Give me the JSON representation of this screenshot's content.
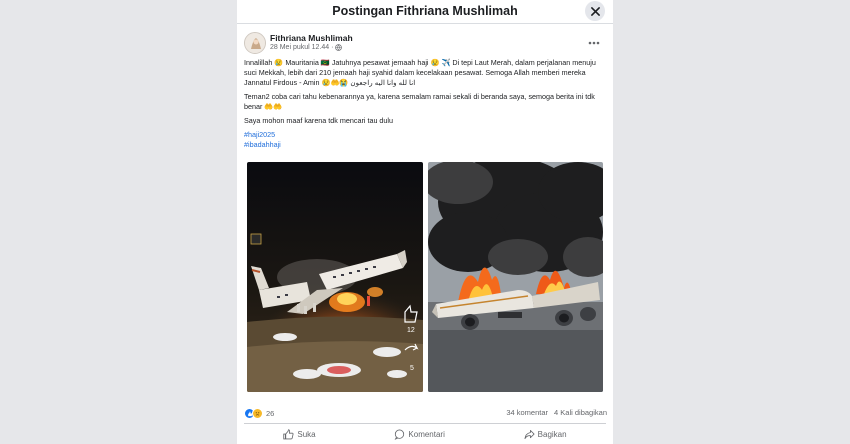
{
  "modal": {
    "title": "Postingan Fithriana Mushlimah"
  },
  "post": {
    "author": "Fithriana Mushlimah",
    "timestamp": "28 Mei pukul 12.44 · ",
    "paragraphs": [
      "Innalillah 😢 Mauritania 🇲🇷 Jatuhnya pesawat jemaah haji 😢 ✈️ Di tepi Laut Merah, dalam perjalanan menuju suci Mekkah, lebih dari 210 jemaah haji syahid dalam kecelakaan pesawat. Semoga Allah memberi mereka Jannatul Firdous - Amin 😢🤲😭 انا لله وانا اليه راجعون",
      "Teman2 coba cari tahu kebenarannya ya, karena semalam ramai sekali di beranda saya, semoga berita ini tdk benar 🤲🤲",
      "Saya mohon maaf karena tdk mencari tau dulu"
    ],
    "hashtags": [
      "#haji2025",
      "#ibadahhaji"
    ],
    "photo_left_badge": "12",
    "photo_left_badge2": "5"
  },
  "footer": {
    "reaction_count": "26",
    "comments": "34 komentar",
    "shares": "4 Kali dibagikan"
  },
  "actions": {
    "like": "Suka",
    "comment": "Komentari",
    "share": "Bagikan"
  },
  "colors": {
    "link": "#216fdb",
    "secondary_text": "#65676b",
    "like_blue": "#1877f2",
    "sad_yellow": "#f7b928"
  }
}
